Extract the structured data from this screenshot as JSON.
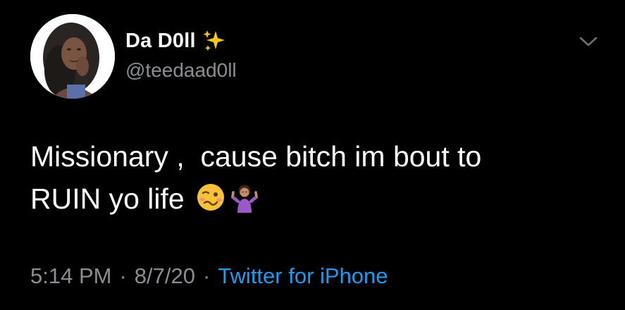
{
  "author": {
    "display_name": "Da D0ll",
    "handle": "@teedaad0ll",
    "name_emoji": "sparkles-icon"
  },
  "tweet": {
    "line1": "Missionary ,  cause bitch im bout to",
    "line2": "RUIN yo life",
    "emojis": [
      "woozy-face-icon",
      "person-shrugging-icon"
    ]
  },
  "meta": {
    "time": "5:14 PM",
    "date": "8/7/20",
    "separator": "·",
    "source": "Twitter for iPhone"
  },
  "colors": {
    "background": "#000000",
    "text": "#ffffff",
    "secondary": "#8a8d91",
    "link": "#1d9bf0"
  }
}
